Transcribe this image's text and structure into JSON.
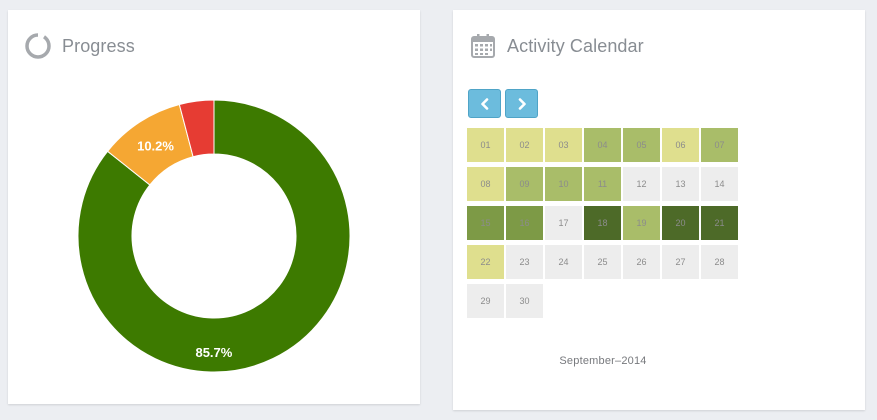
{
  "colors": {
    "page_bg": "#eceef2",
    "nav_button": "#6cbcdd",
    "level0": "#ededed",
    "level1": "#dfdf8e",
    "level2": "#a9bd69",
    "level3": "#7d9a46",
    "level4": "#4d6a28"
  },
  "progress": {
    "title": "Progress",
    "icon": "ring-icon",
    "chart_data": {
      "type": "pie",
      "variant": "donut",
      "slices": [
        {
          "value": 85.7,
          "label": "85.7%",
          "color": "#3d7a00"
        },
        {
          "value": 10.2,
          "label": "10.2%",
          "color": "#f5a733"
        },
        {
          "value": 4.1,
          "label": "",
          "color": "#e63c33"
        }
      ]
    }
  },
  "calendar": {
    "title": "Activity Calendar",
    "icon": "calendar-icon",
    "prev_icon": "chevron-left-icon",
    "next_icon": "chevron-right-icon",
    "month_label": "September–2014",
    "days": [
      {
        "label": "01",
        "level": 1
      },
      {
        "label": "02",
        "level": 1
      },
      {
        "label": "03",
        "level": 1
      },
      {
        "label": "04",
        "level": 2
      },
      {
        "label": "05",
        "level": 2
      },
      {
        "label": "06",
        "level": 1
      },
      {
        "label": "07",
        "level": 2
      },
      {
        "label": "08",
        "level": 1
      },
      {
        "label": "09",
        "level": 2
      },
      {
        "label": "10",
        "level": 2
      },
      {
        "label": "11",
        "level": 2
      },
      {
        "label": "12",
        "level": 0
      },
      {
        "label": "13",
        "level": 0
      },
      {
        "label": "14",
        "level": 0
      },
      {
        "label": "15",
        "level": 3
      },
      {
        "label": "16",
        "level": 3
      },
      {
        "label": "17",
        "level": 0
      },
      {
        "label": "18",
        "level": 4
      },
      {
        "label": "19",
        "level": 2
      },
      {
        "label": "20",
        "level": 4
      },
      {
        "label": "21",
        "level": 4
      },
      {
        "label": "22",
        "level": 1
      },
      {
        "label": "23",
        "level": 0
      },
      {
        "label": "24",
        "level": 0
      },
      {
        "label": "25",
        "level": 0
      },
      {
        "label": "26",
        "level": 0
      },
      {
        "label": "27",
        "level": 0
      },
      {
        "label": "28",
        "level": 0
      },
      {
        "label": "29",
        "level": 0
      },
      {
        "label": "30",
        "level": 0
      }
    ]
  }
}
